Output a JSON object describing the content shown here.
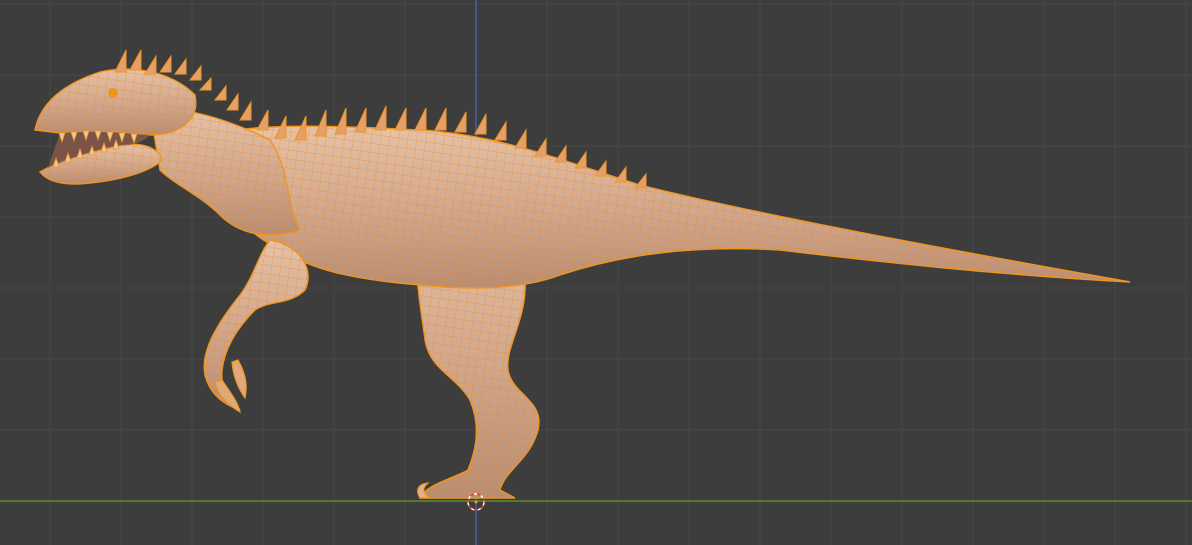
{
  "viewport": {
    "background": "#3d3d3d",
    "grid_color": "#4a4a4a",
    "axis_x_color": "#6a9b2d",
    "axis_z_color": "#4a64b0",
    "selection_color": "#f0951e",
    "mesh_fill": "#d2a98c",
    "cursor_icon": "3d-cursor-icon",
    "object": "raptor-mesh"
  }
}
